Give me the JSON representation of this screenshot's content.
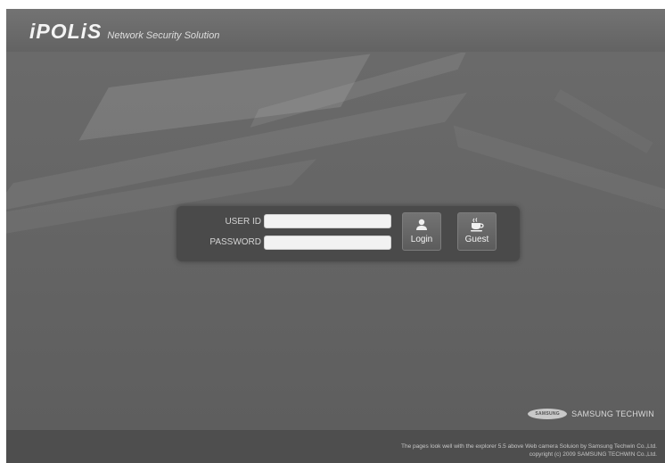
{
  "header": {
    "logo": "iPOLiS",
    "tagline": "Network Security Solution"
  },
  "login": {
    "user_id_label": "USER ID",
    "password_label": "PASSWORD",
    "user_id_value": "",
    "password_value": "",
    "login_button": "Login",
    "guest_button": "Guest",
    "login_icon": "user-icon",
    "guest_icon": "coffee-cup-icon"
  },
  "brand": {
    "badge": "SAMSUNG",
    "name": "SAMSUNG TECHWIN"
  },
  "footer": {
    "line1": "The pages look well with the explorer 5.5 above Web camera Soluion by Samsung Techwin Co.,Ltd.",
    "line2": "copyright (c) 2009 SAMSUNG TECHWIN Co.,Ltd."
  },
  "colors": {
    "background": "#5f5f5f",
    "panel": "#4a4a4a",
    "footer": "#4e4e4e"
  }
}
